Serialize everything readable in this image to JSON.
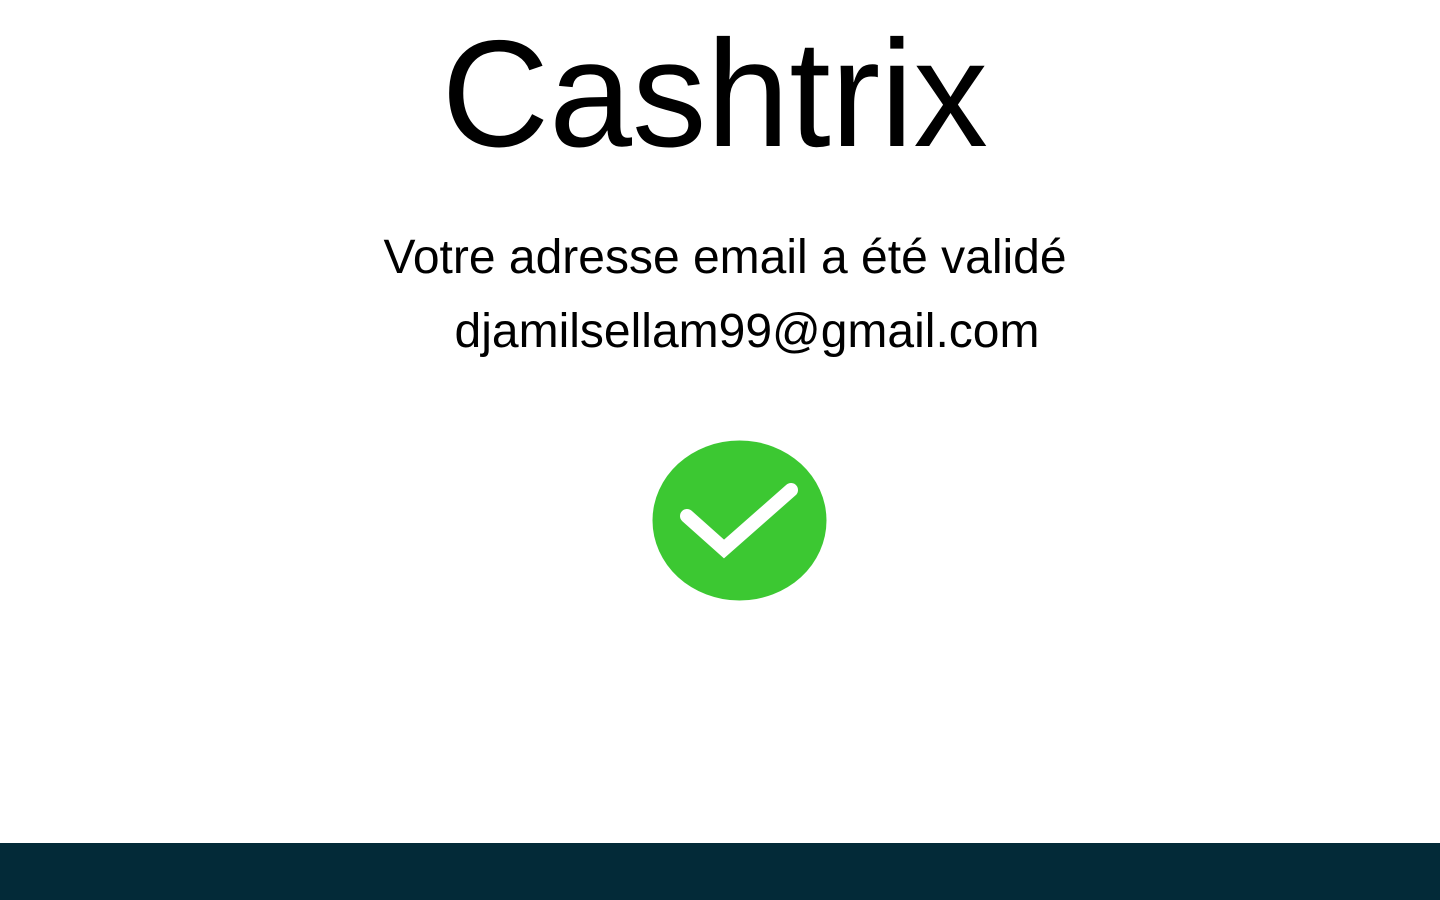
{
  "brand": {
    "name": "Cashtrix"
  },
  "confirmation": {
    "message": "Votre adresse email a été validé",
    "email": "djamilsellam99@gmail.com",
    "status_icon": "check-circle-icon"
  },
  "colors": {
    "success": "#3cc832",
    "footer": "#032a38",
    "text": "#000000",
    "background": "#ffffff"
  }
}
